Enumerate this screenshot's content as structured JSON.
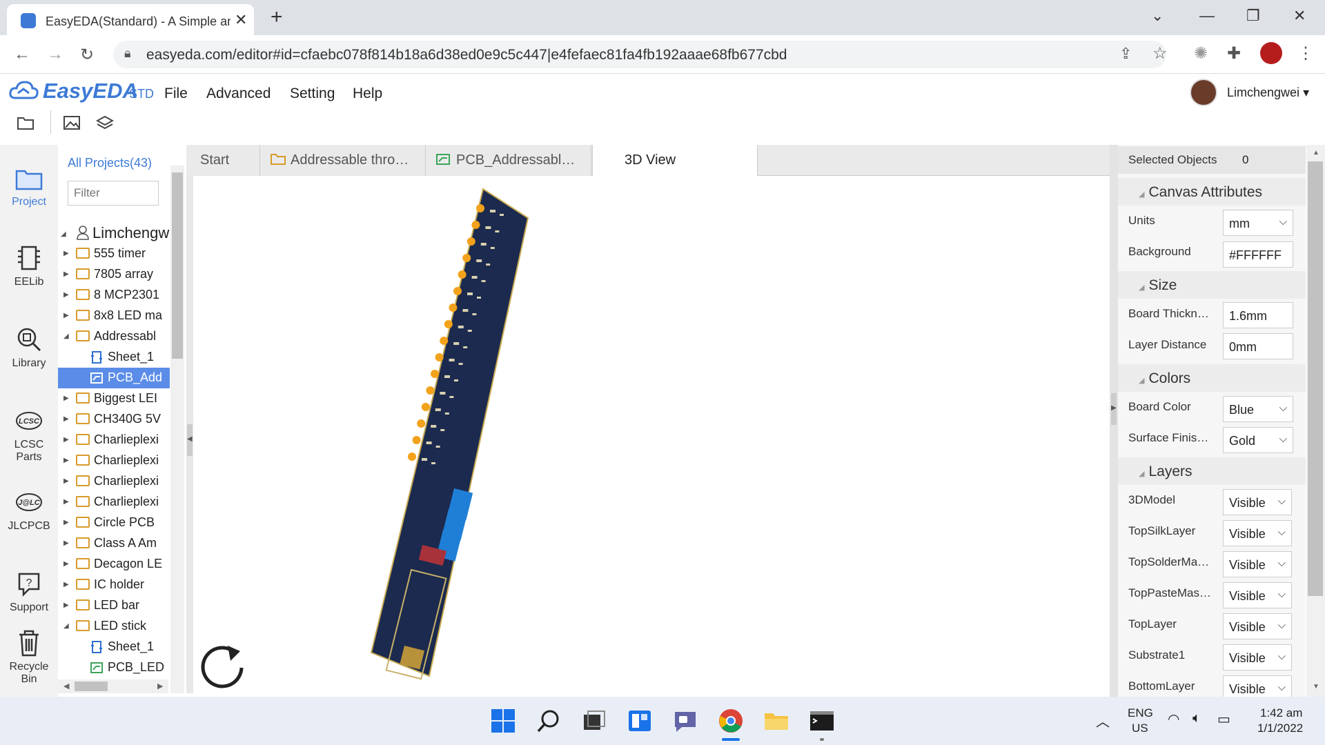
{
  "browser": {
    "tab_title": "EasyEDA(Standard) - A Simple an",
    "url": "easyeda.com/editor#id=cfaebc078f814b18a6d38ed0e9c5c447|e4fefaec81fa4fb192aaae68fb677cbd"
  },
  "app": {
    "logo": "EasyEDA",
    "logo_std": "STD",
    "menu": [
      "File",
      "Advanced",
      "Setting",
      "Help"
    ],
    "user": "Limchengwei"
  },
  "rail": {
    "items": [
      {
        "label": "Project",
        "icon": "folder-icon"
      },
      {
        "label": "EELib",
        "icon": "chip-icon"
      },
      {
        "label": "Library",
        "icon": "library-search-icon"
      },
      {
        "label": "LCSC Parts",
        "icon": "lcsc-logo-icon"
      },
      {
        "label": "JLCPCB",
        "icon": "jlc-logo-icon"
      },
      {
        "label": "Support",
        "icon": "question-icon"
      },
      {
        "label": "Recycle Bin",
        "icon": "trash-icon"
      }
    ]
  },
  "projects": {
    "all_label": "All Projects(43)",
    "filter_placeholder": "Filter",
    "root": "Limchengw",
    "rows": [
      {
        "label": "555 timer",
        "type": "folder",
        "depth": 1
      },
      {
        "label": "7805 array",
        "type": "folder",
        "depth": 1
      },
      {
        "label": "8 MCP2301",
        "type": "folder",
        "depth": 1
      },
      {
        "label": "8x8 LED ma",
        "type": "folder",
        "depth": 1
      },
      {
        "label": "Addressabl",
        "type": "folder-open",
        "depth": 1
      },
      {
        "label": "Sheet_1",
        "type": "sheet",
        "depth": 2
      },
      {
        "label": "PCB_Add",
        "type": "pcb",
        "depth": 2,
        "selected": true
      },
      {
        "label": "Biggest LEI",
        "type": "folder",
        "depth": 1
      },
      {
        "label": "CH340G 5V",
        "type": "folder",
        "depth": 1
      },
      {
        "label": "Charlieplexi",
        "type": "folder",
        "depth": 1
      },
      {
        "label": "Charlieplexi",
        "type": "folder",
        "depth": 1
      },
      {
        "label": "Charlieplexi",
        "type": "folder",
        "depth": 1
      },
      {
        "label": "Charlieplexi",
        "type": "folder",
        "depth": 1
      },
      {
        "label": "Circle PCB",
        "type": "folder",
        "depth": 1
      },
      {
        "label": "Class A Am",
        "type": "folder",
        "depth": 1
      },
      {
        "label": "Decagon LE",
        "type": "folder",
        "depth": 1
      },
      {
        "label": "IC holder",
        "type": "folder",
        "depth": 1
      },
      {
        "label": "LED bar",
        "type": "folder",
        "depth": 1
      },
      {
        "label": "LED stick",
        "type": "folder-open",
        "depth": 1
      },
      {
        "label": "Sheet_1",
        "type": "sheet",
        "depth": 2
      },
      {
        "label": "PCB_LED",
        "type": "pcb",
        "depth": 2
      }
    ]
  },
  "editor_tabs": [
    "Start",
    "Addressable thro…",
    "PCB_Addressabl…",
    "3D View"
  ],
  "right_panel": {
    "selected_label": "Selected Objects",
    "selected_count": "0",
    "canvas_header": "Canvas Attributes",
    "units_label": "Units",
    "units_value": "mm",
    "background_label": "Background",
    "background_value": "#FFFFFF",
    "size_header": "Size",
    "board_thickness_label": "Board Thickn…",
    "board_thickness_value": "1.6mm",
    "layer_distance_label": "Layer Distance",
    "layer_distance_value": "0mm",
    "colors_header": "Colors",
    "board_color_label": "Board Color",
    "board_color_value": "Blue",
    "surface_finish_label": "Surface Finis…",
    "surface_finish_value": "Gold",
    "layers_header": "Layers",
    "layers": [
      {
        "label": "3DModel",
        "value": "Visible"
      },
      {
        "label": "TopSilkLayer",
        "value": "Visible"
      },
      {
        "label": "TopSolderMa…",
        "value": "Visible"
      },
      {
        "label": "TopPasteMas…",
        "value": "Visible"
      },
      {
        "label": "TopLayer",
        "value": "Visible"
      },
      {
        "label": "Substrate1",
        "value": "Visible"
      },
      {
        "label": "BottomLayer",
        "value": "Visible"
      }
    ]
  },
  "taskbar": {
    "lang_line1": "ENG",
    "lang_line2": "US",
    "time": "1:42 am",
    "date": "1/1/2022"
  },
  "colors": {
    "accent": "#3d7ad6",
    "board": "#1b2a4e",
    "led": "#f2a21b"
  }
}
